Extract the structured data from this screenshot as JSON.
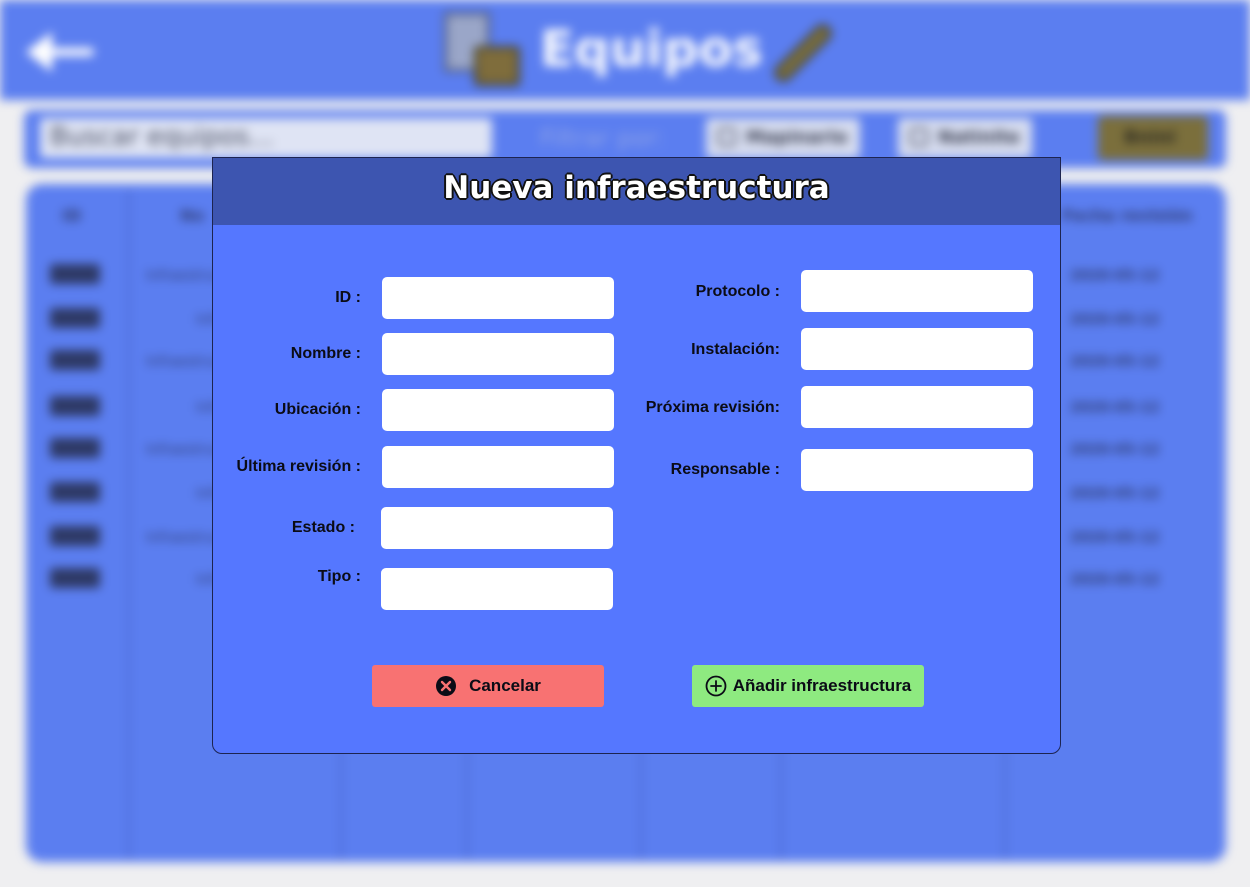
{
  "background": {
    "header": {
      "title": "Equipos"
    },
    "toolbar": {
      "search_placeholder": "Buscar equipos...",
      "filter_label": "Filtrar por:",
      "chips": [
        "Mapinario",
        "Natinite"
      ],
      "dark_button_label": "Bnini"
    },
    "table": {
      "headers": [
        "ID",
        "No",
        "Fecha revisión"
      ],
      "rows": [
        {
          "name": "Infraestructura",
          "date": "2020-05-12"
        },
        {
          "name": "Infra",
          "date": "2020-05-12"
        },
        {
          "name": "Infraestructura",
          "date": "2020-05-12"
        },
        {
          "name": "Infra",
          "date": "2020-05-12"
        },
        {
          "name": "Infraestructura",
          "date": "2020-05-12"
        },
        {
          "name": "Infra",
          "date": "2020-05-12"
        },
        {
          "name": "Infraestructura",
          "date": "2020-05-12"
        },
        {
          "name": "Infra",
          "date": "2020-05-12"
        }
      ]
    }
  },
  "modal": {
    "title": "Nueva infraestructura",
    "left_fields": [
      {
        "label": "ID :",
        "value": ""
      },
      {
        "label": "Nombre :",
        "value": ""
      },
      {
        "label": "Ubicación :",
        "value": ""
      },
      {
        "label": "Última revisión :",
        "value": ""
      },
      {
        "label": "Estado :",
        "value": ""
      },
      {
        "label": "Tipo :",
        "value": ""
      }
    ],
    "right_fields": [
      {
        "label": "Protocolo :",
        "value": ""
      },
      {
        "label": "Instalación:",
        "value": ""
      },
      {
        "label": "Próxima revisión:",
        "value": ""
      },
      {
        "label": "Responsable :",
        "value": ""
      }
    ],
    "cancel_label": "Cancelar",
    "add_label": "Añadir infraestructura"
  },
  "colors": {
    "header_bg": "#5b7ef0",
    "modal_bg": "#5577ff",
    "modal_header": "#3d55b0",
    "cancel": "#f87272",
    "add": "#8eea80"
  }
}
